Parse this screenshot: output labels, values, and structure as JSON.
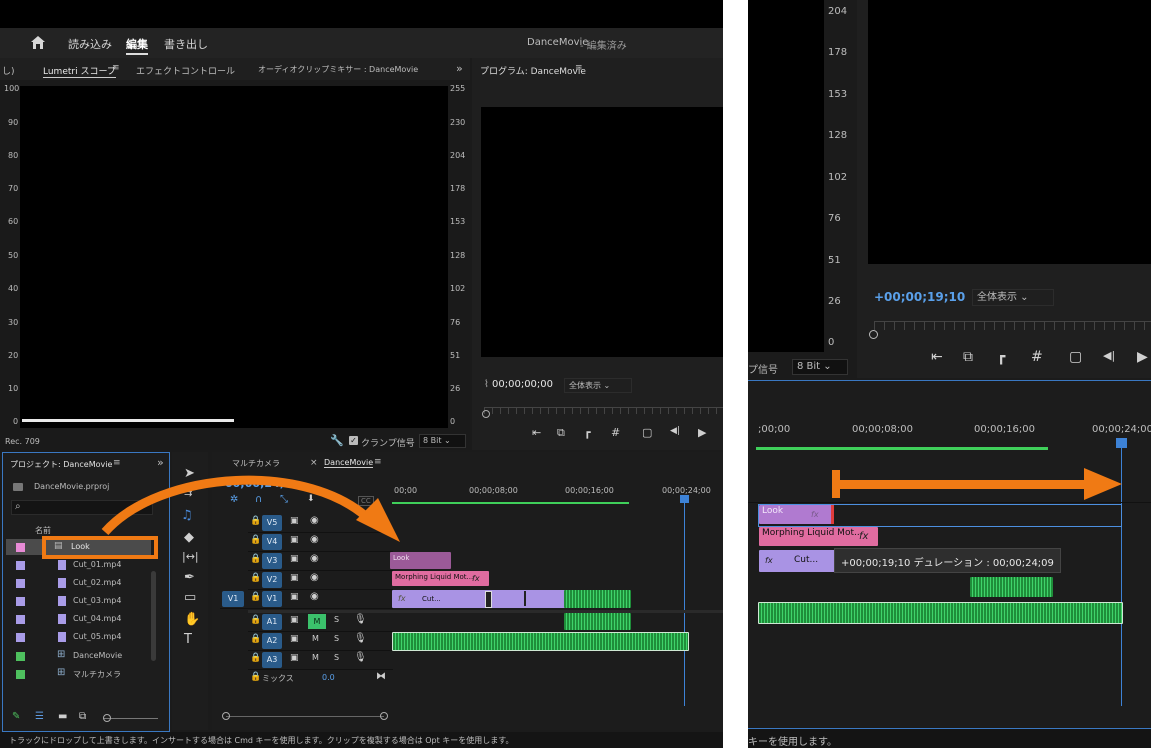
{
  "main_window": {
    "menu": {
      "import": "読み込み",
      "edit": "編集",
      "export": "書き出し"
    },
    "project_title": "DanceMovie",
    "project_status": "- 編集済み",
    "tabs_top": {
      "partial": "し)",
      "lumetri": "Lumetri スコープ",
      "effect_controls": "エフェクトコントロール",
      "audio_mixer": "オーディオクリップミキサー : DanceMovie"
    },
    "scope_left_ticks": [
      "100",
      "90",
      "80",
      "70",
      "60",
      "50",
      "40",
      "30",
      "20",
      "10",
      "0"
    ],
    "scope_right_ticks": [
      "255",
      "230",
      "204",
      "178",
      "153",
      "128",
      "102",
      "76",
      "51",
      "26",
      "0"
    ],
    "scope_footer": {
      "rec": "Rec. 709",
      "clamp": "クランプ信号",
      "bitdepth": "8 Bit"
    },
    "program": {
      "title": "プログラム: DanceMovie",
      "timecode": "00;00;00;00",
      "zoom": "全体表示"
    },
    "project_panel": {
      "title": "プロジェクト: DanceMovie",
      "file": "DanceMovie.prproj",
      "column_header": "名前",
      "items": [
        {
          "name": "Look",
          "color": "#e88bd6"
        },
        {
          "name": "Cut_01.mp4",
          "color": "#a99ce8"
        },
        {
          "name": "Cut_02.mp4",
          "color": "#a99ce8"
        },
        {
          "name": "Cut_03.mp4",
          "color": "#a99ce8"
        },
        {
          "name": "Cut_04.mp4",
          "color": "#a99ce8"
        },
        {
          "name": "Cut_05.mp4",
          "color": "#a99ce8"
        },
        {
          "name": "DanceMovie",
          "color": "#4ec05e"
        },
        {
          "name": "マルチカメラ",
          "color": "#4ec05e"
        }
      ]
    },
    "timeline": {
      "tab_multicam": "マルチカメラ",
      "tab_sequence": "DanceMovie",
      "timecode_partial": "00;00;24;0",
      "ruler": [
        "00;00",
        "00;00;08;00",
        "00;00;16;00",
        "00;00;24;00"
      ],
      "video_tracks": [
        "V5",
        "V4",
        "V3",
        "V2",
        "V1"
      ],
      "source_patch": "V1",
      "audio_tracks": [
        "A1",
        "A2",
        "A3"
      ],
      "audio_ms": {
        "m": "M",
        "s": "S"
      },
      "mix_label": "ミックス",
      "mix_value": "0.0",
      "clips": {
        "look": "Look",
        "morph": "Morphing Liquid Mot...",
        "cut": "Cut...",
        "fx": "fx"
      }
    },
    "status_bar": "トラックにドロップして上書きします。インサートする場合は Cmd キーを使用します。クリップを複製する場合は Opt キーを使用します。"
  },
  "zoom_panel": {
    "scope_ticks": [
      "204",
      "178",
      "153",
      "128",
      "102",
      "76",
      "51",
      "26",
      "0"
    ],
    "timecode": "+00;00;19;10",
    "zoom": "全体表示",
    "bit_label_partial": "プ信号",
    "bitdepth": "8 Bit",
    "ruler": [
      ";00;00",
      "00;00;08;00",
      "00;00;16;00",
      "00;00;24;00"
    ],
    "clips": {
      "look": "Look",
      "morph": "Morphing Liquid Mot...",
      "cut": "Cut...",
      "fx": "fx"
    },
    "tooltip": "+00;00;19;10 デュレーション : 00;00;24;09",
    "status_partial": "キーを使用します。"
  }
}
